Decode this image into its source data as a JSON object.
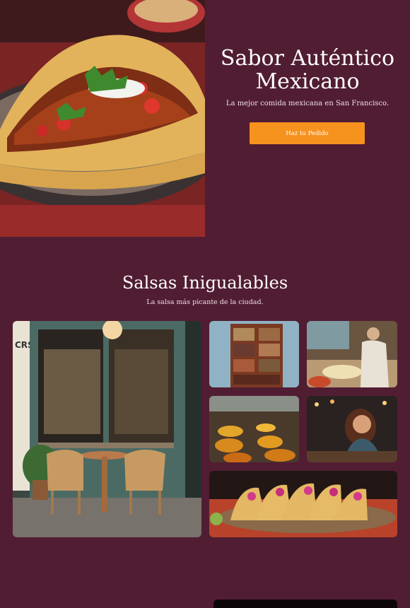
{
  "hero": {
    "title_line1": "Sabor Auténtico",
    "title_line2": "Mexicano",
    "subtitle": "La mejor comida mexicana en San Francisco.",
    "cta_label": "Haz tu Pedido"
  },
  "salsas": {
    "title": "Salsas Inigualables",
    "subtitle": "La salsa más picante de la ciudad."
  },
  "gallery": {
    "cafe_sign": "CRS"
  },
  "colors": {
    "background": "#511d33",
    "accent": "#f6921e",
    "text": "#ffffff"
  }
}
